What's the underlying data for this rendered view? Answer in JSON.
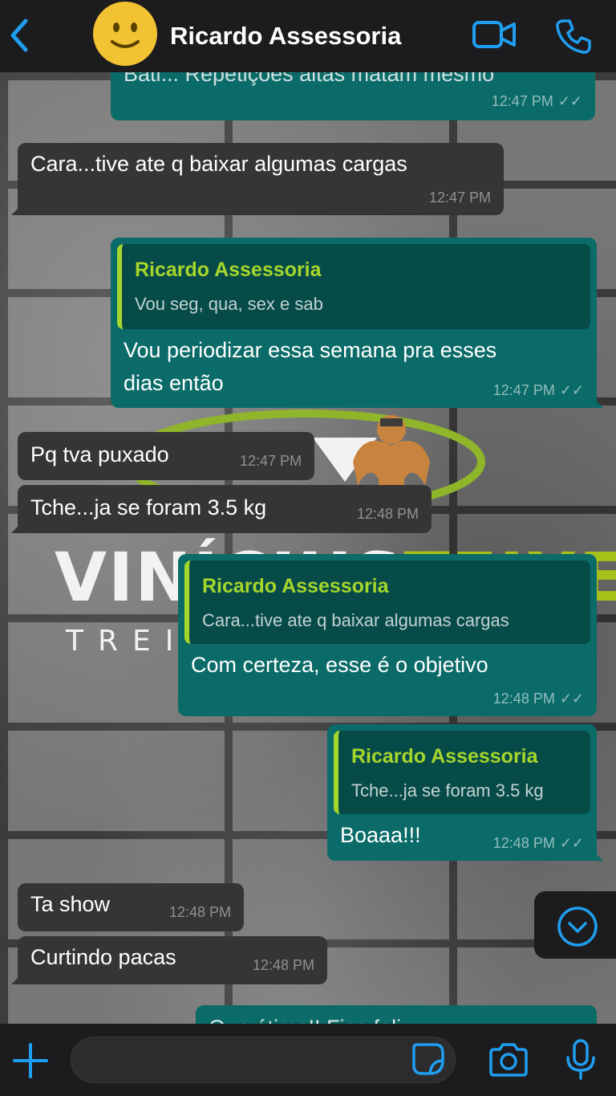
{
  "header": {
    "contact_name": "Ricardo Assessoria"
  },
  "watermark": {
    "main": "VINÍCIUS",
    "accent": "TEIXEIRA",
    "sub": "TREI"
  },
  "messages": [
    {
      "direction": "out",
      "text": "Bati... Repetições altas matam mesmo",
      "time": "12:47 PM"
    },
    {
      "direction": "in",
      "text": "Cara...tive ate q baixar algumas cargas",
      "time": "12:47 PM"
    },
    {
      "direction": "out",
      "quote_author": "Ricardo Assessoria",
      "quote_text": "Vou seg, qua, sex e sab",
      "text_line1": "Vou periodizar essa semana pra esses",
      "text_line2": "dias então",
      "time": "12:47 PM"
    },
    {
      "direction": "in",
      "text": "Pq tva puxado",
      "time": "12:47 PM"
    },
    {
      "direction": "in",
      "text": "Tche...ja se foram 3.5 kg",
      "time": "12:48 PM"
    },
    {
      "direction": "out",
      "quote_author": "Ricardo Assessoria",
      "quote_text": "Cara...tive ate q baixar algumas cargas",
      "text": "Com certeza, esse é o objetivo",
      "time": "12:48 PM"
    },
    {
      "direction": "out",
      "quote_author": "Ricardo Assessoria",
      "quote_text": "Tche...ja se foram 3.5 kg",
      "text": "Boaaa!!!",
      "time": "12:48 PM"
    },
    {
      "direction": "in",
      "text": "Ta show",
      "time": "12:48 PM"
    },
    {
      "direction": "in",
      "text": "Curtindo pacas",
      "time": "12:48 PM"
    },
    {
      "direction": "out",
      "text": "Que ótimo!! Fico feliz",
      "time": ""
    }
  ],
  "colors": {
    "accent": "#1f9ef0",
    "outgoing_bubble": "#0b6b68",
    "incoming_bubble": "#353535",
    "quote_author": "#a6d62c"
  }
}
